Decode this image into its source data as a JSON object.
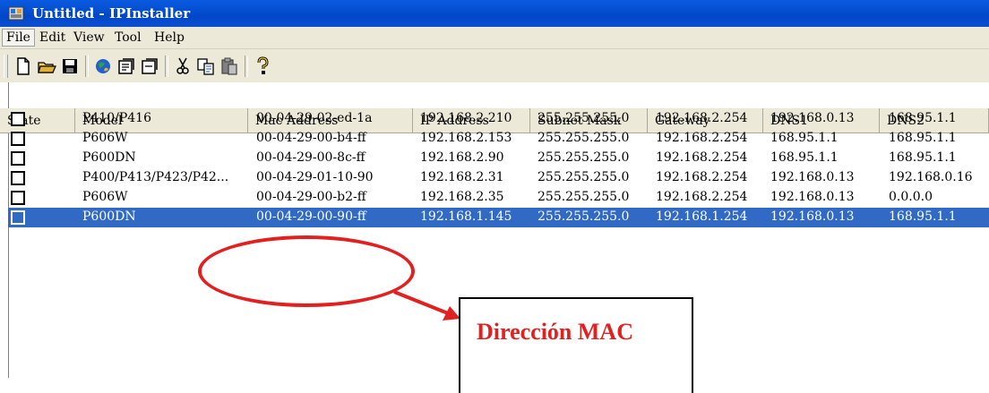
{
  "window": {
    "title": "Untitled - IPInstaller"
  },
  "menu": [
    "File",
    "Edit",
    "View",
    "Tool",
    "Help"
  ],
  "toolbar": {
    "icons": [
      "new-icon",
      "open-icon",
      "save-icon",
      "search-device-icon",
      "properties-icon",
      "properties-alt-icon",
      "cut-icon",
      "copy-icon",
      "paste-icon",
      "help-icon"
    ]
  },
  "table": {
    "columns": [
      "State",
      "Model",
      "Mac Address",
      "IP Address",
      "Subnet Mask",
      "Gateway",
      "DNS1",
      "DNS2"
    ],
    "rows": [
      [
        "",
        "P410/P416",
        "00-04-29-02-ed-1a",
        "192.168.2.210",
        "255.255.255.0",
        "192.168.2.254",
        "192.168.0.13",
        "168.95.1.1"
      ],
      [
        "",
        "P606W",
        "00-04-29-00-b4-ff",
        "192.168.2.153",
        "255.255.255.0",
        "192.168.2.254",
        "168.95.1.1",
        "168.95.1.1"
      ],
      [
        "",
        "P600DN",
        "00-04-29-00-8c-ff",
        "192.168.2.90",
        "255.255.255.0",
        "192.168.2.254",
        "168.95.1.1",
        "168.95.1.1"
      ],
      [
        "",
        "P400/P413/P423/P42...",
        "00-04-29-01-10-90",
        "192.168.2.31",
        "255.255.255.0",
        "192.168.2.254",
        "192.168.0.13",
        "192.168.0.16"
      ],
      [
        "",
        "P606W",
        "00-04-29-00-b2-ff",
        "192.168.2.35",
        "255.255.255.0",
        "192.168.2.254",
        "192.168.0.13",
        "0.0.0.0"
      ],
      [
        "",
        "P600DN",
        "00-04-29-00-90-ff",
        "192.168.1.145",
        "255.255.255.0",
        "192.168.1.254",
        "192.168.0.13",
        "168.95.1.1"
      ]
    ],
    "selected_row": 5
  },
  "annotation": {
    "label": "Dirección MAC"
  },
  "colors": {
    "titlebar": "#0a5be0",
    "selection": "#316ac5",
    "annotation": "#e32020",
    "chrome": "#ece9d8"
  }
}
